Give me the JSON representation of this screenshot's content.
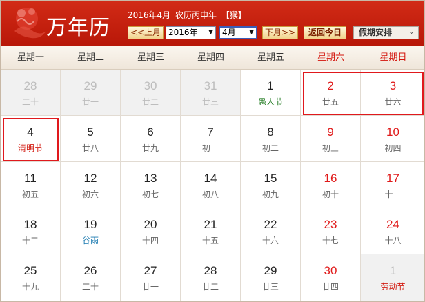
{
  "header": {
    "app_title": "万年历",
    "date_info": "2016年4月",
    "lunar_year": "农历丙申年",
    "zodiac": "【猴】",
    "prev_label": "<<上月",
    "year_value": "2016年",
    "month_value": "4月",
    "next_label": "下月>>",
    "today_label": "返回今日",
    "holiday_label": "假期安排",
    "dropdown_icon": "▼",
    "holiday_icon": "⌄"
  },
  "colors": {
    "header": "#c92310",
    "weekend": "#e01a1a",
    "highlight": "#e0191d",
    "festival": "#d31e14",
    "term": "#1b7ab0",
    "festival_green": "#1f7a1f"
  },
  "weekdays": [
    "星期一",
    "星期二",
    "星期三",
    "星期四",
    "星期五",
    "星期六",
    "星期日"
  ],
  "weeks": [
    [
      {
        "day": "28",
        "lunar": "二十",
        "other": true
      },
      {
        "day": "29",
        "lunar": "廿一",
        "other": true
      },
      {
        "day": "30",
        "lunar": "廿二",
        "other": true
      },
      {
        "day": "31",
        "lunar": "廿三",
        "other": true
      },
      {
        "day": "1",
        "lunar": "愚人节",
        "style": "festival-green"
      },
      {
        "day": "2",
        "lunar": "廿五",
        "weekend": true,
        "highlight": true
      },
      {
        "day": "3",
        "lunar": "廿六",
        "weekend": true,
        "highlight": true
      }
    ],
    [
      {
        "day": "4",
        "lunar": "清明节",
        "style": "festival-red",
        "highlight": true
      },
      {
        "day": "5",
        "lunar": "廿八"
      },
      {
        "day": "6",
        "lunar": "廿九"
      },
      {
        "day": "7",
        "lunar": "初一"
      },
      {
        "day": "8",
        "lunar": "初二"
      },
      {
        "day": "9",
        "lunar": "初三",
        "weekend": true
      },
      {
        "day": "10",
        "lunar": "初四",
        "weekend": true
      }
    ],
    [
      {
        "day": "11",
        "lunar": "初五"
      },
      {
        "day": "12",
        "lunar": "初六"
      },
      {
        "day": "13",
        "lunar": "初七"
      },
      {
        "day": "14",
        "lunar": "初八"
      },
      {
        "day": "15",
        "lunar": "初九"
      },
      {
        "day": "16",
        "lunar": "初十",
        "weekend": true
      },
      {
        "day": "17",
        "lunar": "十一",
        "weekend": true
      }
    ],
    [
      {
        "day": "18",
        "lunar": "十二"
      },
      {
        "day": "19",
        "lunar": "谷雨",
        "style": "term"
      },
      {
        "day": "20",
        "lunar": "十四"
      },
      {
        "day": "21",
        "lunar": "十五"
      },
      {
        "day": "22",
        "lunar": "十六"
      },
      {
        "day": "23",
        "lunar": "十七",
        "weekend": true
      },
      {
        "day": "24",
        "lunar": "十八",
        "weekend": true
      }
    ],
    [
      {
        "day": "25",
        "lunar": "十九"
      },
      {
        "day": "26",
        "lunar": "二十"
      },
      {
        "day": "27",
        "lunar": "廿一"
      },
      {
        "day": "28",
        "lunar": "廿二"
      },
      {
        "day": "29",
        "lunar": "廿三"
      },
      {
        "day": "30",
        "lunar": "廿四",
        "weekend": true
      },
      {
        "day": "1",
        "lunar": "劳动节",
        "other": true,
        "style": "festival-red"
      }
    ]
  ]
}
